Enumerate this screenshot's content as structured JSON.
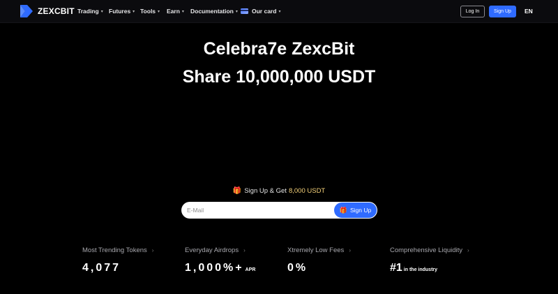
{
  "brand": {
    "name": "ZEXCBIT",
    "logo_icon": "zexcbit-logo-icon",
    "accent_color": "#2f6bff"
  },
  "nav": {
    "items": [
      {
        "label": "Trading"
      },
      {
        "label": "Futures"
      },
      {
        "label": "Tools"
      },
      {
        "label": "Earn"
      },
      {
        "label": "Documentation"
      },
      {
        "label": "Our card",
        "icon": "credit-card-icon"
      }
    ],
    "login_label": "Log In",
    "signup_label": "Sign Up",
    "language": "EN"
  },
  "hero": {
    "title_line1": "Celebra7e ZexcBit",
    "title_line2": "Share 10,000,000 USDT"
  },
  "promo": {
    "icon": "gift-icon",
    "text": "Sign Up & Get",
    "amount": "8,000 USDT"
  },
  "signup_form": {
    "email_placeholder": "E-Mail",
    "email_value": "",
    "button_label": "Sign Up",
    "button_icon": "gift-icon"
  },
  "stats": [
    {
      "label": "Most Trending Tokens",
      "value": "4,077",
      "suffix": ""
    },
    {
      "label": "Everyday Airdrops",
      "value": "1,000%+",
      "suffix": "APR"
    },
    {
      "label": "Xtremely Low Fees",
      "value": "0%",
      "suffix": ""
    },
    {
      "label": "Comprehensive Liquidity",
      "value": "#1",
      "suffix": "in the industry"
    }
  ]
}
